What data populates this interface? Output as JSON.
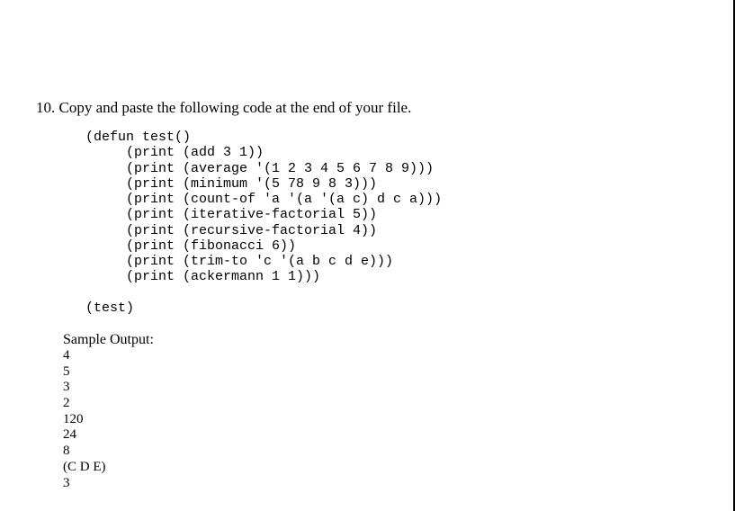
{
  "item_number": "10.",
  "instruction_text": "Copy and paste the following code at the end of your file.",
  "code_lines": [
    "(defun test()",
    "     (print (add 3 1))",
    "     (print (average '(1 2 3 4 5 6 7 8 9)))",
    "     (print (minimum '(5 78 9 8 3)))",
    "     (print (count-of 'a '(a '(a c) d c a)))",
    "     (print (iterative-factorial 5))",
    "     (print (recursive-factorial 4))",
    "     (print (fibonacci 6))",
    "     (print (trim-to 'c '(a b c d e)))",
    "     (print (ackermann 1 1)))",
    "",
    "(test)"
  ],
  "sample_output_label": "Sample Output:",
  "sample_output_lines": [
    "4",
    "5",
    "3",
    "2",
    "120",
    "24",
    "8",
    "(C D E)",
    "3"
  ]
}
